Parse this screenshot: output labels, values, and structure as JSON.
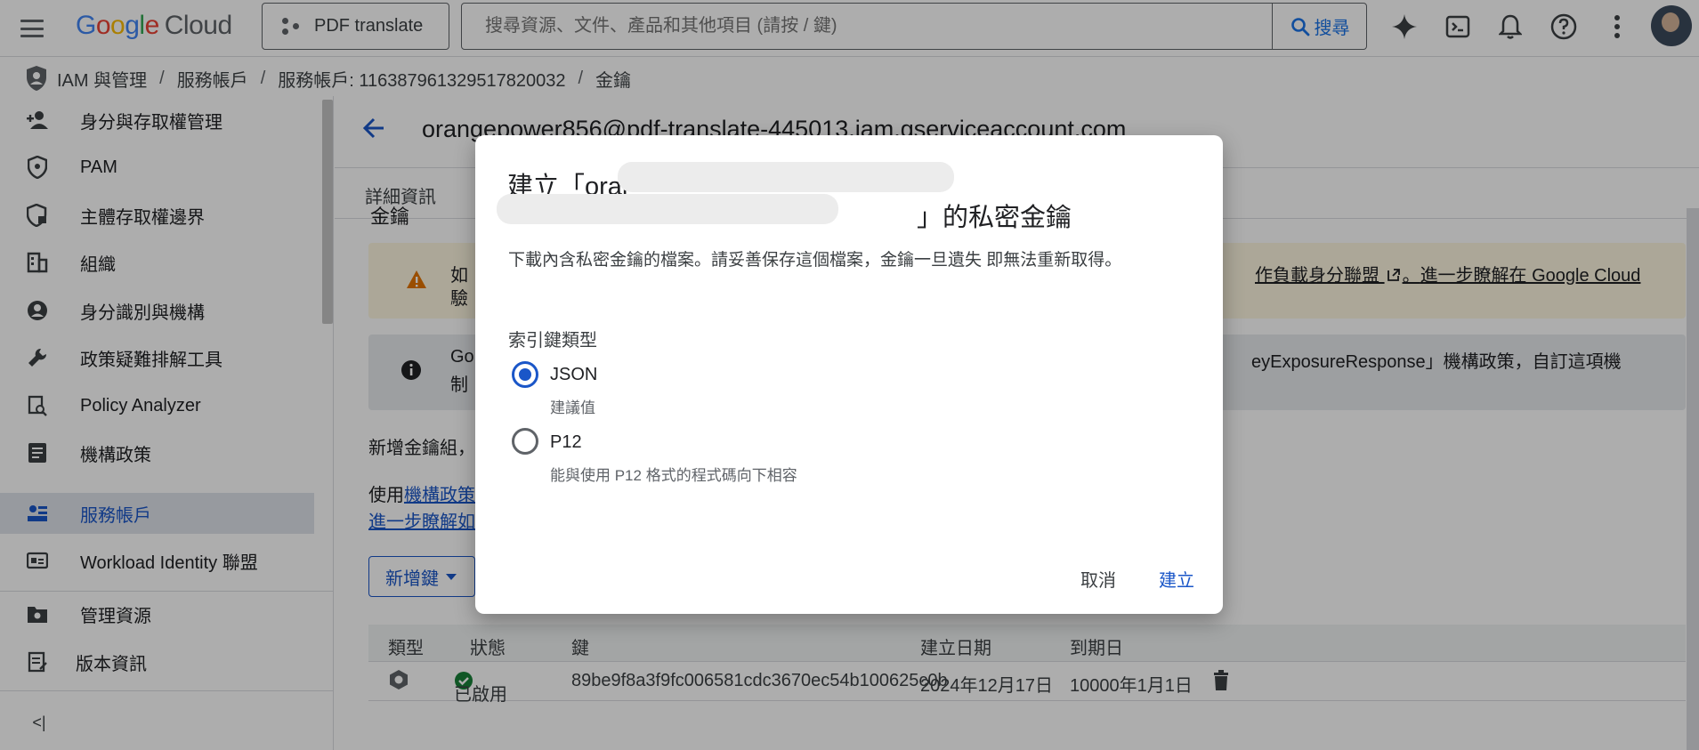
{
  "topbar": {
    "logo_google": "Google",
    "logo_cloud": "Cloud",
    "project_name": "PDF translate",
    "search_placeholder": "搜尋資源、文件、產品和其他項目 (請按 / 鍵)",
    "search_button": "搜尋"
  },
  "breadcrumb": {
    "items": [
      "IAM 與管理",
      "服務帳戶",
      "服務帳戶: 116387961329517820032",
      "金鑰"
    ],
    "separator": "/"
  },
  "sidebar": {
    "items": [
      {
        "label": "身分與存取權管理",
        "icon": "person-add-icon"
      },
      {
        "label": "PAM",
        "icon": "shield-icon"
      },
      {
        "label": "主體存取權邊界",
        "icon": "shield-lock-icon"
      },
      {
        "label": "組織",
        "icon": "building-icon"
      },
      {
        "label": "身分識別與機構",
        "icon": "account-circle-icon"
      },
      {
        "label": "政策疑難排解工具",
        "icon": "wrench-icon"
      },
      {
        "label": "Policy Analyzer",
        "icon": "policy-search-icon"
      },
      {
        "label": "機構政策",
        "icon": "list-document-icon"
      },
      {
        "label": "服務帳戶",
        "icon": "service-account-icon",
        "active": true
      },
      {
        "label": "Workload Identity 聯盟",
        "icon": "id-card-icon"
      },
      {
        "label": "管理資源",
        "icon": "settings-folder-icon"
      },
      {
        "label": "版本資訊",
        "icon": "release-notes-icon"
      }
    ],
    "collapse_label": "<|"
  },
  "main": {
    "service_account_email": "orangepower856@pdf-translate-445013.iam.gserviceaccount.com",
    "tab_details": "詳細資訊",
    "section_heading_partial": "金鑰",
    "warning_line1": "如",
    "warning_line2": "驗",
    "warning_link_text": "作負載身分聯盟",
    "warning_link_after": "。",
    "warning_link2_text": "進一步瞭解在 Google Cloud",
    "info_line1": "Go",
    "info_line2": "制",
    "info_right_text": "eyExposureResponse」機構政策，自訂這項機",
    "para1": "新增金鑰組，",
    "para2_prefix": "使用",
    "para2_link": "機構政策",
    "para3_link": "進一步瞭解如",
    "add_key_button": "新增鍵",
    "table": {
      "headers": [
        "類型",
        "狀態",
        "鍵",
        "建立日期",
        "到期日"
      ],
      "rows": [
        {
          "status": "已啟用",
          "key": "89be9f8a3f9fc006581cdc3670ec54b100625c0b",
          "created": "2024年12月17日",
          "expires": "10000年1月1日"
        }
      ]
    }
  },
  "dialog": {
    "title_prefix": "建立「orar",
    "title_suffix": "」的私密金鑰",
    "description": "下載內含私密金鑰的檔案。請妥善保存這個檔案，金鑰一旦遺失 即無法重新取得。",
    "key_type_label": "索引鍵類型",
    "options": [
      {
        "label": "JSON",
        "sublabel": "建議值",
        "selected": true
      },
      {
        "label": "P12",
        "sublabel": "能與使用 P12 格式的程式碼向下相容",
        "selected": false
      }
    ],
    "cancel_button": "取消",
    "create_button": "建立"
  },
  "colors": {
    "accent": "#1a56c8",
    "warning_bg": "#fef7e0",
    "info_bg": "#e8eaed",
    "active_nav_bg": "#dfe3eb",
    "success": "#188038"
  }
}
